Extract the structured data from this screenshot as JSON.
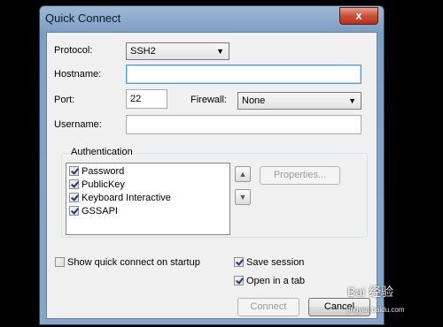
{
  "window": {
    "title": "Quick Connect",
    "close_label": "x"
  },
  "form": {
    "protocol_label": "Protocol:",
    "protocol_value": "SSH2",
    "hostname_label": "Hostname:",
    "hostname_value": "",
    "port_label": "Port:",
    "port_value": "22",
    "firewall_label": "Firewall:",
    "firewall_value": "None",
    "username_label": "Username:",
    "username_value": ""
  },
  "auth": {
    "group_title": "Authentication",
    "items": [
      {
        "label": "Password",
        "checked": true
      },
      {
        "label": "PublicKey",
        "checked": true
      },
      {
        "label": "Keyboard Interactive",
        "checked": true
      },
      {
        "label": "GSSAPI",
        "checked": true
      }
    ],
    "properties_label": "Properties..."
  },
  "options": {
    "show_on_startup": {
      "label": "Show quick connect on startup",
      "checked": false
    },
    "save_session": {
      "label": "Save session",
      "checked": true
    },
    "open_in_tab": {
      "label": "Open in a tab",
      "checked": true
    }
  },
  "buttons": {
    "connect_label": "Connect",
    "cancel_label": "Cancel"
  },
  "icons": {
    "up": "arrow-up-icon",
    "down": "arrow-down-icon"
  },
  "watermark": {
    "text": "Bai 经验",
    "sub": "jingyan.baidu.com"
  }
}
